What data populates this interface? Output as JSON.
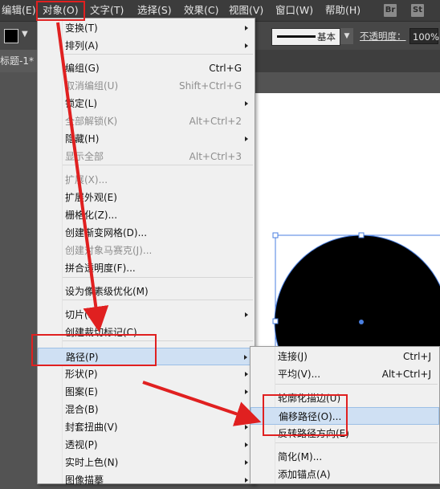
{
  "menubar": {
    "items": [
      "编辑(E)",
      "对象(O)",
      "文字(T)",
      "选择(S)",
      "效果(C)",
      "视图(V)",
      "窗口(W)",
      "帮助(H)"
    ],
    "app_icons": [
      "Br",
      "St"
    ]
  },
  "control_bar": {
    "stroke_style": "基本",
    "opacity_label": "不透明度：",
    "opacity_value": "100%"
  },
  "document_tab": {
    "title": "标题-1* @"
  },
  "object_menu": [
    {
      "label": "变换(T)",
      "shortcut": "",
      "submenu": true,
      "enabled": true
    },
    {
      "label": "排列(A)",
      "shortcut": "",
      "submenu": true,
      "enabled": true
    },
    {
      "label": "编组(G)",
      "shortcut": "Ctrl+G",
      "submenu": false,
      "enabled": true
    },
    {
      "label": "取消编组(U)",
      "shortcut": "Shift+Ctrl+G",
      "submenu": false,
      "enabled": false
    },
    {
      "label": "锁定(L)",
      "shortcut": "",
      "submenu": true,
      "enabled": true
    },
    {
      "label": "全部解锁(K)",
      "shortcut": "Alt+Ctrl+2",
      "submenu": false,
      "enabled": false
    },
    {
      "label": "隐藏(H)",
      "shortcut": "",
      "submenu": true,
      "enabled": true
    },
    {
      "label": "显示全部",
      "shortcut": "Alt+Ctrl+3",
      "submenu": false,
      "enabled": false
    },
    {
      "label": "扩展(X)...",
      "shortcut": "",
      "submenu": false,
      "enabled": false
    },
    {
      "label": "扩展外观(E)",
      "shortcut": "",
      "submenu": false,
      "enabled": true
    },
    {
      "label": "栅格化(Z)...",
      "shortcut": "",
      "submenu": false,
      "enabled": true
    },
    {
      "label": "创建渐变网格(D)...",
      "shortcut": "",
      "submenu": false,
      "enabled": true
    },
    {
      "label": "创建对象马赛克(J)...",
      "shortcut": "",
      "submenu": false,
      "enabled": false
    },
    {
      "label": "拼合透明度(F)...",
      "shortcut": "",
      "submenu": false,
      "enabled": true
    },
    {
      "label": "设为像素级优化(M)",
      "shortcut": "",
      "submenu": false,
      "enabled": true
    },
    {
      "label": "切片(S)",
      "shortcut": "",
      "submenu": true,
      "enabled": true
    },
    {
      "label": "创建裁切标记(C)",
      "shortcut": "",
      "submenu": false,
      "enabled": true
    },
    {
      "label": "路径(P)",
      "shortcut": "",
      "submenu": true,
      "enabled": true,
      "highlighted": true
    },
    {
      "label": "形状(P)",
      "shortcut": "",
      "submenu": true,
      "enabled": true
    },
    {
      "label": "图案(E)",
      "shortcut": "",
      "submenu": true,
      "enabled": true
    },
    {
      "label": "混合(B)",
      "shortcut": "",
      "submenu": true,
      "enabled": true
    },
    {
      "label": "封套扭曲(V)",
      "shortcut": "",
      "submenu": true,
      "enabled": true
    },
    {
      "label": "透视(P)",
      "shortcut": "",
      "submenu": true,
      "enabled": true
    },
    {
      "label": "实时上色(N)",
      "shortcut": "",
      "submenu": true,
      "enabled": true
    },
    {
      "label": "图像描摹",
      "shortcut": "",
      "submenu": true,
      "enabled": true
    }
  ],
  "path_submenu": [
    {
      "label": "连接(J)",
      "shortcut": "Ctrl+J",
      "enabled": true
    },
    {
      "label": "平均(V)...",
      "shortcut": "Alt+Ctrl+J",
      "enabled": true
    },
    {
      "label": "轮廓化描边(U)",
      "shortcut": "",
      "enabled": true
    },
    {
      "label": "偏移路径(O)...",
      "shortcut": "",
      "enabled": true,
      "highlighted": true
    },
    {
      "label": "反转路径方向(E)",
      "shortcut": "",
      "enabled": true
    },
    {
      "label": "简化(M)...",
      "shortcut": "",
      "enabled": true
    },
    {
      "label": "添加锚点(A)",
      "shortcut": "",
      "enabled": true
    }
  ],
  "colors": {
    "annotation_red": "#e02020",
    "highlight_blue": "#cfe0f3",
    "anchor_blue": "#4a7fe0"
  },
  "icons": [
    "fill-swatch-icon",
    "chevron-down-icon",
    "submenu-arrow-icon",
    "red-arrow-annotation"
  ]
}
